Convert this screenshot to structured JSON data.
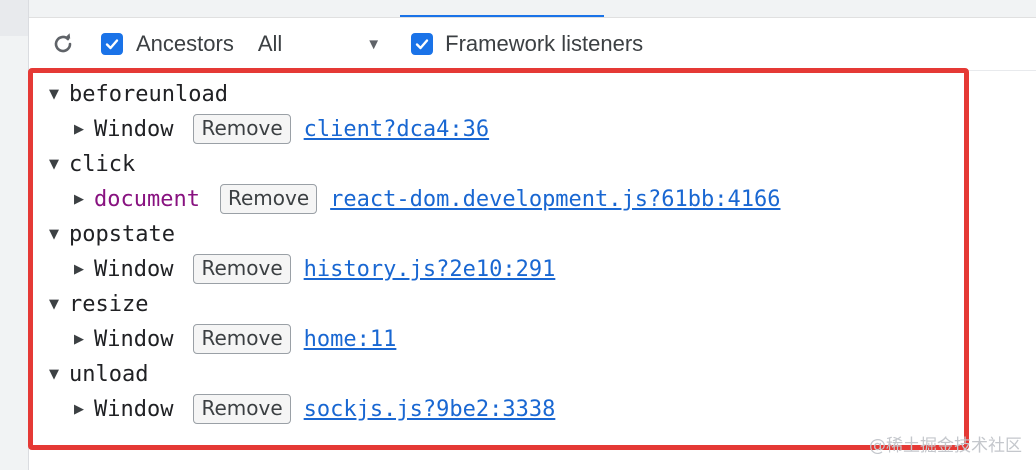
{
  "toolbar": {
    "ancestors_label": "Ancestors",
    "ancestors_checked": true,
    "filter_value": "All",
    "framework_label": "Framework listeners",
    "framework_checked": true
  },
  "events": [
    {
      "name": "beforeunload",
      "listeners": [
        {
          "target": "Window",
          "target_kind": "window",
          "remove_label": "Remove",
          "source": "client?dca4:36"
        }
      ]
    },
    {
      "name": "click",
      "listeners": [
        {
          "target": "document",
          "target_kind": "node",
          "remove_label": "Remove",
          "source": "react-dom.development.js?61bb:4166"
        }
      ]
    },
    {
      "name": "popstate",
      "listeners": [
        {
          "target": "Window",
          "target_kind": "window",
          "remove_label": "Remove",
          "source": "history.js?2e10:291"
        }
      ]
    },
    {
      "name": "resize",
      "listeners": [
        {
          "target": "Window",
          "target_kind": "window",
          "remove_label": "Remove",
          "source": "home:11"
        }
      ]
    },
    {
      "name": "unload",
      "listeners": [
        {
          "target": "Window",
          "target_kind": "window",
          "remove_label": "Remove",
          "source": "sockjs.js?9be2:3338"
        }
      ]
    }
  ],
  "watermark": "@稀土掘金技术社区",
  "colors": {
    "accent": "#1a73e8",
    "highlight": "#e53935",
    "node_target": "#881280",
    "link": "#1967d2"
  }
}
